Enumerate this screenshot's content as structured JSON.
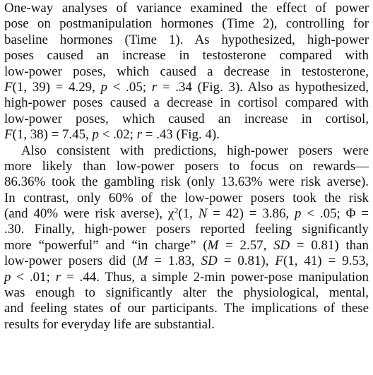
{
  "paper": {
    "paragraph_1": {
      "lines": [
        [
          {
            "t": "One-way analyses of variance examined the effect of power",
            "i": false
          }
        ],
        [
          {
            "t": "pose on postmanipulation hormones (Time 2), controlling for",
            "i": false
          }
        ],
        [
          {
            "t": "baseline hormones (Time 1). As hypothesized, high-power",
            "i": false
          }
        ],
        [
          {
            "t": "poses caused an increase in testosterone compared with",
            "i": false
          }
        ],
        [
          {
            "t": "low-power poses, which caused a decrease in testosterone,",
            "i": false
          }
        ],
        [
          {
            "t": "F",
            "i": true
          },
          {
            "t": "(1, 39) = 4.29, ",
            "i": false
          },
          {
            "t": "p",
            "i": true
          },
          {
            "t": " < .05; ",
            "i": false
          },
          {
            "t": "r",
            "i": true
          },
          {
            "t": " = .34 (Fig. 3). Also as hypothesized,",
            "i": false
          }
        ],
        [
          {
            "t": "high-power poses caused a decrease in cortisol compared with",
            "i": false
          }
        ],
        [
          {
            "t": "low-power poses, which caused an increase in cortisol,",
            "i": false
          }
        ],
        [
          {
            "t": "F",
            "i": true
          },
          {
            "t": "(1, 38) = 7.45, ",
            "i": false
          },
          {
            "t": "p",
            "i": true
          },
          {
            "t": " < .02; ",
            "i": false
          },
          {
            "t": "r",
            "i": true
          },
          {
            "t": " = .43 (Fig. 4).",
            "i": false
          }
        ]
      ]
    },
    "paragraph_2": {
      "lines": [
        [
          {
            "t": "Also consistent with predictions, high-power posers were",
            "i": false
          }
        ],
        [
          {
            "t": "more likely than low-power posers to focus on rewards—",
            "i": false
          }
        ],
        [
          {
            "t": "86.36% took the gambling risk (only 13.63% were risk averse).",
            "i": false
          }
        ],
        [
          {
            "t": "In contrast, only 60% of the low-power posers took the risk",
            "i": false
          }
        ],
        [
          {
            "t": "(and 40% were risk averse), χ",
            "i": false
          },
          {
            "t": "2",
            "i": false,
            "sup": true
          },
          {
            "t": "(1, ",
            "i": false
          },
          {
            "t": "N",
            "i": true
          },
          {
            "t": " = 42) = 3.86, ",
            "i": false
          },
          {
            "t": "p",
            "i": true
          },
          {
            "t": " < .05; Φ =",
            "i": false
          }
        ],
        [
          {
            "t": ".30. Finally, high-power posers reported feeling significantly",
            "i": false
          }
        ],
        [
          {
            "t": "more “powerful” and “in charge” (",
            "i": false
          },
          {
            "t": "M",
            "i": true
          },
          {
            "t": " = 2.57, ",
            "i": false
          },
          {
            "t": "SD",
            "i": true
          },
          {
            "t": " = 0.81) than",
            "i": false
          }
        ],
        [
          {
            "t": "low-power posers did (",
            "i": false
          },
          {
            "t": "M",
            "i": true
          },
          {
            "t": " = 1.83, ",
            "i": false
          },
          {
            "t": "SD",
            "i": true
          },
          {
            "t": " = 0.81), ",
            "i": false
          },
          {
            "t": "F",
            "i": true
          },
          {
            "t": "(1, 41) = 9.53,",
            "i": false
          }
        ],
        [
          {
            "t": "p",
            "i": true
          },
          {
            "t": " < .01; ",
            "i": false
          },
          {
            "t": "r",
            "i": true
          },
          {
            "t": " = .44. Thus, a simple 2-min power-pose manipulation",
            "i": false
          }
        ],
        [
          {
            "t": "was enough to significantly alter the physiological, mental,",
            "i": false
          }
        ],
        [
          {
            "t": "and feeling states of our participants. The implications of these",
            "i": false
          }
        ],
        [
          {
            "t": "results for everyday life are substantial.",
            "i": false
          }
        ]
      ]
    }
  }
}
